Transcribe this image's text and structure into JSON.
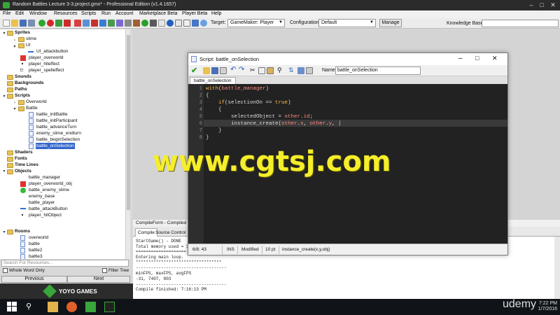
{
  "window": {
    "title": "Random Battles Lecture 3-3.project.gmx* - Professional Edition (v1.4.1657)"
  },
  "menu": [
    "File",
    "Edit",
    "Window",
    "Resources",
    "Scripts",
    "Run",
    "Account",
    "Marketplace Beta",
    "Player Beta",
    "Help"
  ],
  "toolbar": {
    "target_label": "Target:",
    "target_value": "GameMaker: Player",
    "config_label": "Configuration:",
    "config_value": "Default",
    "manage_label": "Manage",
    "kb_label": "Knowledge Base:"
  },
  "tree": [
    {
      "label": "Sprites",
      "bold": true
    },
    {
      "label": "slime"
    },
    {
      "label": "UI"
    },
    {
      "label": "UI_attackbutton"
    },
    {
      "label": "player_overworld"
    },
    {
      "label": "player_hiteffect"
    },
    {
      "label": "player_spelleffect"
    },
    {
      "label": "Sounds",
      "bold": true
    },
    {
      "label": "Backgrounds",
      "bold": true
    },
    {
      "label": "Paths",
      "bold": true
    },
    {
      "label": "Scripts",
      "bold": true
    },
    {
      "label": "Overworld"
    },
    {
      "label": "Battle"
    },
    {
      "label": "battle_initBattle"
    },
    {
      "label": "battle_initParticipant"
    },
    {
      "label": "battle_advanceTurn"
    },
    {
      "label": "enemy_slime_endturn"
    },
    {
      "label": "battle_beginSelection"
    },
    {
      "label": "battle_onSelection"
    },
    {
      "label": "Shaders",
      "bold": true
    },
    {
      "label": "Fonts",
      "bold": true
    },
    {
      "label": "Time Lines",
      "bold": true
    },
    {
      "label": "Objects",
      "bold": true
    },
    {
      "label": "battle_manager"
    },
    {
      "label": "player_overworld_obj"
    },
    {
      "label": "battle_enemy_slime"
    },
    {
      "label": "enemy_base"
    },
    {
      "label": "battle_player"
    },
    {
      "label": "battle_attackButton"
    },
    {
      "label": "player_hitObject"
    },
    {
      "label": "Rooms",
      "bold": true
    },
    {
      "label": "overworld"
    },
    {
      "label": "battle"
    },
    {
      "label": "battle2"
    },
    {
      "label": "battle3"
    }
  ],
  "left_bottom": {
    "search_placeholder": "Search For Resources...",
    "whole_word": "Whole Word Only",
    "filter_tree": "Filter Tree",
    "previous": "Previous",
    "next": "Next",
    "logo_text": "YOYO GAMES"
  },
  "script_window": {
    "title": "Script: battle_onSelection",
    "name_label": "Name:",
    "name_value": "battle_onSelection",
    "tab": "battle_onSelection",
    "status": {
      "pos": "6/8: 43",
      "mode": "INS",
      "modified": "Modified",
      "size": "10 pt",
      "hint": "instance_create(x,y,obj)"
    }
  },
  "code": [
    {
      "n": "1",
      "parts": [
        [
          "kw",
          "with"
        ],
        [
          "id",
          "("
        ],
        [
          "var",
          "battle_manager"
        ],
        [
          "id",
          ")"
        ]
      ]
    },
    {
      "n": "2",
      "parts": [
        [
          "id",
          "{"
        ]
      ]
    },
    {
      "n": "3",
      "parts": [
        [
          "id",
          "    "
        ],
        [
          "kw",
          "if"
        ],
        [
          "id",
          "(selectionOn == "
        ],
        [
          "kw",
          "true"
        ],
        [
          "id",
          ")"
        ]
      ]
    },
    {
      "n": "4",
      "parts": [
        [
          "id",
          "    {"
        ]
      ]
    },
    {
      "n": "5",
      "parts": [
        [
          "id",
          "        selectedObject = "
        ],
        [
          "var",
          "other"
        ],
        [
          "id",
          "."
        ],
        [
          "var",
          "id"
        ],
        [
          "id",
          ";"
        ]
      ]
    },
    {
      "n": "6",
      "parts": [
        [
          "id",
          "        instance_create("
        ],
        [
          "var",
          "other"
        ],
        [
          "id",
          "."
        ],
        [
          "var",
          "x"
        ],
        [
          "id",
          ", "
        ],
        [
          "var",
          "other"
        ],
        [
          "id",
          "."
        ],
        [
          "var",
          "y"
        ],
        [
          "id",
          ", |"
        ]
      ]
    },
    {
      "n": "7",
      "parts": [
        [
          "id",
          "    }"
        ]
      ]
    },
    {
      "n": "8",
      "parts": [
        [
          "id",
          "}"
        ]
      ]
    }
  ],
  "compile": {
    "header": "CompileForm - Compiled at",
    "tab1": "Compile",
    "tab2": "Source Control",
    "lines": [
      "StartGame() - DONE",
      "Total memory used = 398",
      "====================",
      "Entering main loop.",
      "**********************************",
      "------------------------------------",
      "minFPS, maxFPS, avgFPS",
      "-31, 7407, 803",
      "------------------------------------",
      "Compile finished: 7:16:13 PM"
    ]
  },
  "watermark": "www.cgtsj.com",
  "taskbar": {
    "time": "7:22 PM",
    "date": "1/7/2016",
    "brand": "udemy"
  },
  "colors": {
    "accent_selected": "#3366cc",
    "watermark": "#f5ee2a",
    "editor_bg": "#222222"
  }
}
